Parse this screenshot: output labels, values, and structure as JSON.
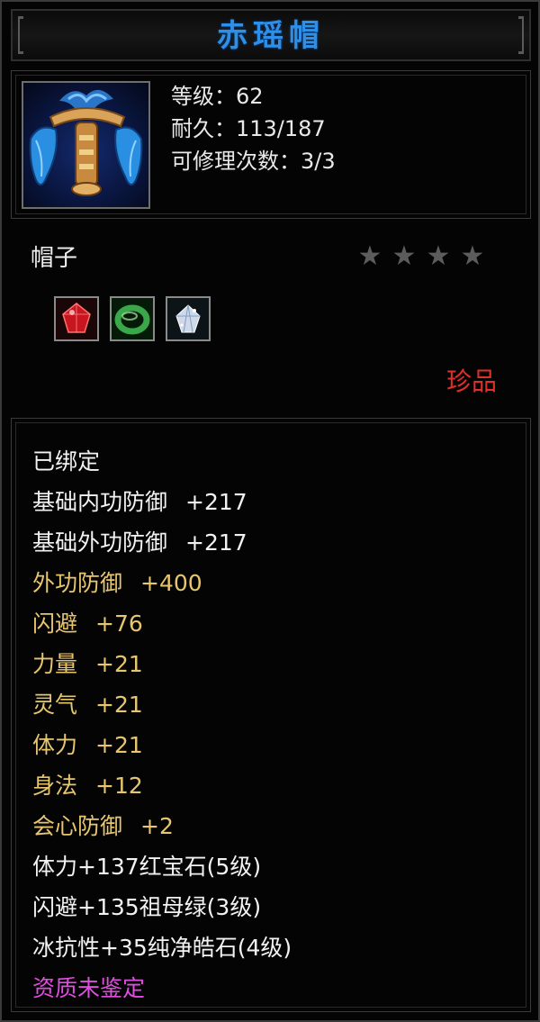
{
  "item": {
    "name": "赤瑶帽",
    "stats": [
      "等级：62",
      "耐久：113/187",
      "可修理次数：3/3"
    ],
    "type": "帽子",
    "star_count": 4,
    "star_symbol": "★",
    "rarity": "珍品"
  },
  "gems": [
    {
      "name": "ruby-gem-icon",
      "color": "#c8161e"
    },
    {
      "name": "emerald-gem-icon",
      "color": "#3aa84a"
    },
    {
      "name": "diamond-gem-icon",
      "color": "#cfd8e8"
    }
  ],
  "attributes": {
    "bound": "已绑定",
    "base": [
      {
        "name": "基础内功防御",
        "value": "+217"
      },
      {
        "name": "基础外功防御",
        "value": "+217"
      }
    ],
    "extra": [
      {
        "name": "外功防御",
        "value": "+400"
      },
      {
        "name": "闪避",
        "value": "+76"
      },
      {
        "name": "力量",
        "value": "+21"
      },
      {
        "name": "灵气",
        "value": "+21"
      },
      {
        "name": "体力",
        "value": "+21"
      },
      {
        "name": "身法",
        "value": "+12"
      },
      {
        "name": "会心防御",
        "value": "+2"
      }
    ],
    "gem_bonuses": [
      "体力+137红宝石(5级)",
      "闪避+135祖母绿(3级)",
      "冰抗性+35纯净皓石(4级)"
    ],
    "quality": "资质未鉴定"
  },
  "colors": {
    "title": "#2f8fe8",
    "normal_text": "#f2f2f2",
    "extra_attr": "#e7c66e",
    "rarity": "#e0302a",
    "quality": "#e04ee0",
    "star_inactive": "#5c5c5c"
  }
}
